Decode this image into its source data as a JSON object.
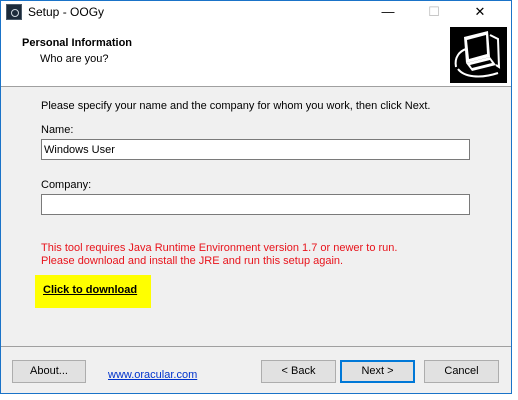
{
  "window": {
    "title": "Setup - OOGy",
    "controls": {
      "minimize": "—",
      "maximize": "☐",
      "close": "✕"
    }
  },
  "header": {
    "title": "Personal Information",
    "subtitle": "Who are you?"
  },
  "form": {
    "intro": "Please specify your name and the company for whom you work, then click Next.",
    "name_label": "Name:",
    "name_value": "Windows User",
    "company_label": "Company:",
    "company_value": ""
  },
  "warning": {
    "line1": "This tool requires Java Runtime Environment version 1.7 or newer to run.",
    "line2": "Please download and install the JRE and run this setup again."
  },
  "download": {
    "label": "Click to download",
    "highlight_color": "#ffff00"
  },
  "footer": {
    "about_label": "About...",
    "site_link": "www.oracular.com",
    "back_label": "< Back",
    "next_label": "Next >",
    "cancel_label": "Cancel"
  },
  "colors": {
    "warning": "#e8141c",
    "link": "#0033cc",
    "default_button_border": "#0078d7"
  },
  "icons": {
    "app": "app-icon",
    "header_logo": "computer-setup-icon"
  }
}
